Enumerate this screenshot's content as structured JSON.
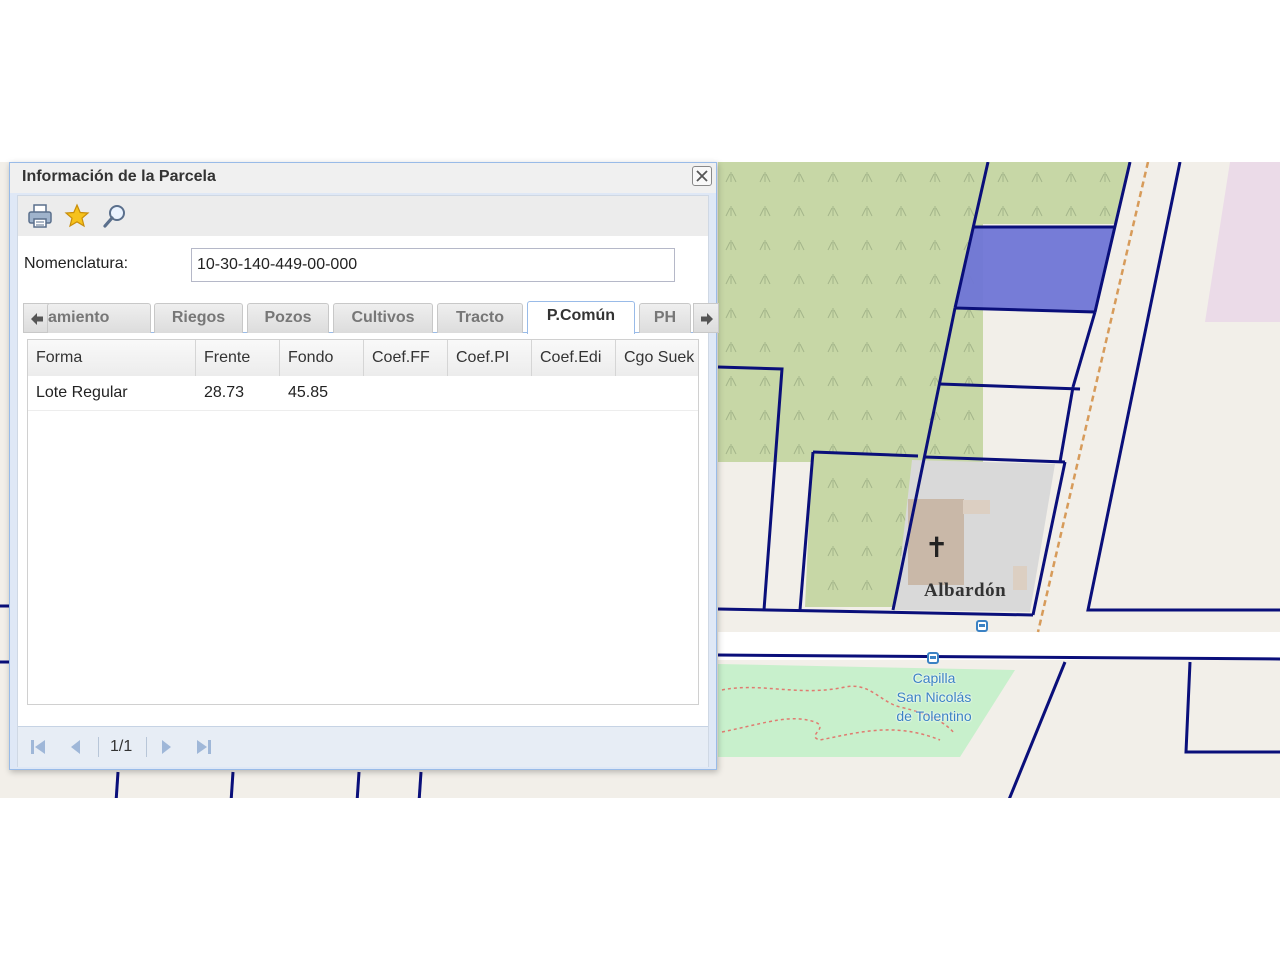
{
  "window": {
    "title": "Información de la Parcela",
    "close_icon": "close-icon"
  },
  "toolbar": {
    "icons": [
      "printer-icon",
      "star-icon",
      "magnifier-icon"
    ]
  },
  "form": {
    "nomenclatura_label": "Nomenclatura:",
    "nomenclatura_value": "10-30-140-449-00-000"
  },
  "tabs": {
    "items": [
      {
        "label": "amiento"
      },
      {
        "label": "Riegos"
      },
      {
        "label": "Pozos"
      },
      {
        "label": "Cultivos"
      },
      {
        "label": "Tracto"
      },
      {
        "label": "P.Común",
        "active": true
      },
      {
        "label": "PH"
      }
    ]
  },
  "grid": {
    "columns": [
      "Forma",
      "Frente",
      "Fondo",
      "Coef.FF",
      "Coef.PI",
      "Coef.Edi",
      "Cgo Suek"
    ],
    "rows": [
      [
        "Lote Regular",
        "28.73",
        "45.85",
        "",
        "",
        "",
        ""
      ]
    ]
  },
  "paging": {
    "indicator": "1/1"
  },
  "map": {
    "place_label": "Albardón",
    "poi_label_line1": "Capilla",
    "poi_label_line2": "San Nicolás",
    "poi_label_line3": "de Tolentino",
    "parcel_line_color": "#0a0f7a",
    "selected_parcel_color": "#6f75d6",
    "farmland_color": "#c7d7a6",
    "park_color": "#c8f0cc"
  }
}
